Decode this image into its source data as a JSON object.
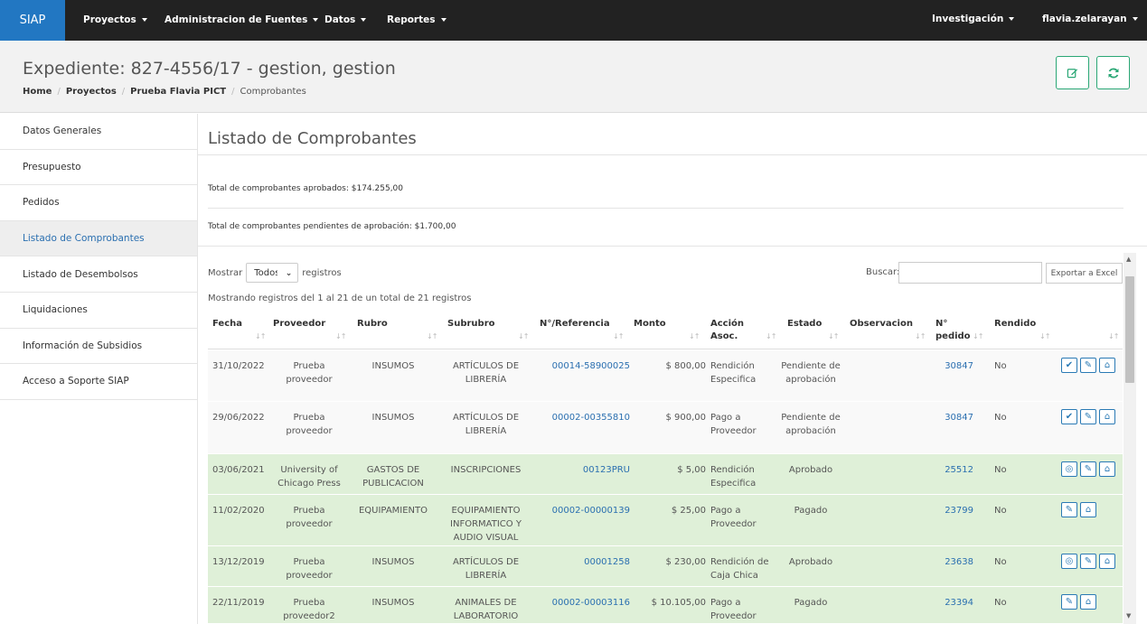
{
  "navbar": {
    "brand": "SIAP",
    "menus": [
      "Proyectos",
      "Administracion de Fuentes",
      "Datos",
      "Reportes"
    ],
    "right_menus": [
      "Investigación",
      "flavia.zelarayan"
    ]
  },
  "header": {
    "title": "Expediente: 827-4556/17 - gestion, gestion",
    "breadcrumb": [
      "Home",
      "Proyectos",
      "Prueba Flavia PICT",
      "Comprobantes"
    ],
    "edit_icon": "edit-icon",
    "refresh_icon": "refresh-icon"
  },
  "sidebar": {
    "items": [
      "Datos Generales",
      "Presupuesto",
      "Pedidos",
      "Listado de Comprobantes",
      "Listado de Desembolsos",
      "Liquidaciones",
      "Información de Subsidios",
      "Acceso a Soporte SIAP"
    ],
    "active": "Listado de Comprobantes"
  },
  "main": {
    "title": "Listado de Comprobantes",
    "total_aprobados": "Total de comprobantes aprobados: $174.255,00",
    "total_pendientes": "Total de comprobantes pendientes de aprobación: $1.700,00",
    "mostrar_label": "Mostrar",
    "mostrar_value": "Todos",
    "registros_label": "registros",
    "buscar_label": "Buscar:",
    "export_label": "Exportar a Excel",
    "info": "Mostrando registros del 1 al 21 de un total de 21 registros"
  },
  "table": {
    "headers": [
      "Fecha",
      "Proveedor",
      "Rubro",
      "Subrubro",
      "N°/Referencia",
      "Monto",
      "Acción Asoc.",
      "Estado",
      "Observacion",
      "N° pedido",
      "Rendido",
      ""
    ],
    "rows": [
      {
        "fecha": "31/10/2022",
        "proveedor": "Prueba proveedor",
        "rubro": "INSUMOS",
        "subrubro": "ARTÍCULOS DE LIBRERÍA",
        "referencia": "00014-58900025",
        "monto": "$ 800,00",
        "accion": "Rendición Especifica",
        "estado": "Pendiente de aprobación",
        "observacion": "",
        "pedido": "30847",
        "rendido": "No",
        "status": "pending"
      },
      {
        "fecha": "29/06/2022",
        "proveedor": "Prueba proveedor",
        "rubro": "INSUMOS",
        "subrubro": "ARTÍCULOS DE LIBRERÍA",
        "referencia": "00002-00355810",
        "monto": "$ 900,00",
        "accion": "Pago a Proveedor",
        "estado": "Pendiente de aprobación",
        "observacion": "",
        "pedido": "30847",
        "rendido": "No",
        "status": "pending"
      },
      {
        "fecha": "03/06/2021",
        "proveedor": "University of Chicago Press",
        "rubro": "GASTOS DE PUBLICACION",
        "subrubro": "INSCRIPCIONES",
        "referencia": "00123PRU",
        "monto": "$ 5,00",
        "accion": "Rendición Especifica",
        "estado": "Aprobado",
        "observacion": "",
        "pedido": "25512",
        "rendido": "No",
        "status": "approved"
      },
      {
        "fecha": "11/02/2020",
        "proveedor": "Prueba proveedor",
        "rubro": "EQUIPAMIENTO",
        "subrubro": "EQUIPAMIENTO INFORMATICO Y AUDIO VISUAL",
        "referencia": "00002-00000139",
        "monto": "$ 25,00",
        "accion": "Pago a Proveedor",
        "estado": "Pagado",
        "observacion": "",
        "pedido": "23799",
        "rendido": "No",
        "status": "paid"
      },
      {
        "fecha": "13/12/2019",
        "proveedor": "Prueba proveedor",
        "rubro": "INSUMOS",
        "subrubro": "ARTÍCULOS DE LIBRERÍA",
        "referencia": "00001258",
        "monto": "$ 230,00",
        "accion": "Rendición de Caja Chica",
        "estado": "Aprobado",
        "observacion": "",
        "pedido": "23638",
        "rendido": "No",
        "status": "approved"
      },
      {
        "fecha": "22/11/2019",
        "proveedor": "Prueba proveedor2",
        "rubro": "INSUMOS",
        "subrubro": "ANIMALES DE LABORATORIO",
        "referencia": "00002-00003116",
        "monto": "$ 10.105,00",
        "accion": "Pago a Proveedor",
        "estado": "Pagado",
        "observacion": "",
        "pedido": "23394",
        "rendido": "No",
        "status": "paid"
      }
    ]
  },
  "colors": {
    "navbar_bg": "#222222",
    "brand_bg": "#2277c2",
    "approved_row": "#dff0d8",
    "link": "#2a6fb0",
    "header_btn": "#2aa775"
  }
}
